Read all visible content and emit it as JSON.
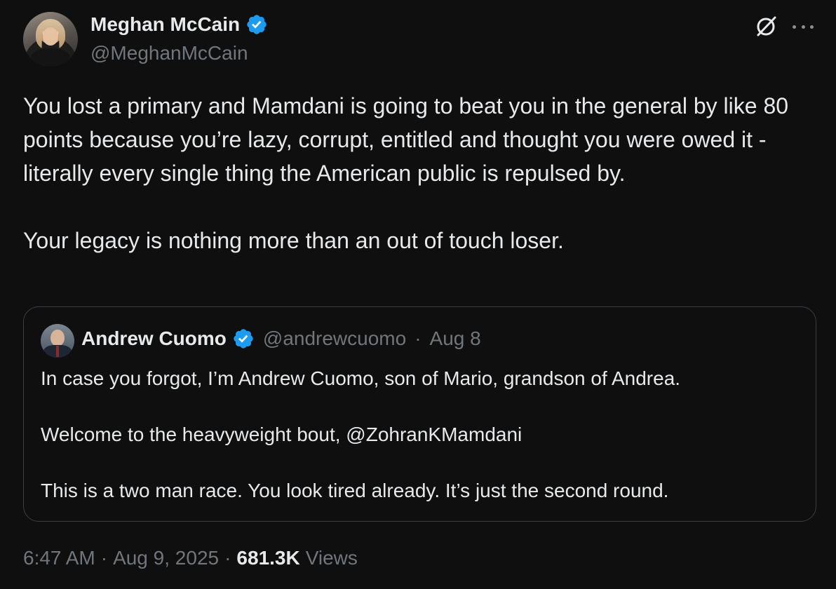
{
  "author": {
    "name": "Meghan McCain",
    "handle": "@MeghanMcCain",
    "verified": true,
    "verified_color": "#1d9bf0"
  },
  "icons": {
    "top_right": [
      "grok-icon",
      "more-icon"
    ],
    "verified": "verified-badge-icon"
  },
  "tweet": {
    "text": "You lost a primary and Mamdani is going to beat you in the general by like 80 points because you’re lazy, corrupt, entitled and thought you were owed it - literally every single thing the American public is repulsed by.\n\nYour legacy is nothing more than an out of touch loser."
  },
  "quote": {
    "name": "Andrew Cuomo",
    "handle": "@andrewcuomo",
    "separator": "·",
    "date": "Aug 8",
    "verified": true,
    "text": "In case you forgot, I’m Andrew Cuomo, son of Mario, grandson of Andrea.\n\nWelcome to the heavyweight bout, @ZohranKMamdani\n\nThis is a two man race. You look tired already. It’s just the second round."
  },
  "footer": {
    "time": "6:47 AM",
    "separator": "·",
    "date": "Aug 9, 2025",
    "views_count": "681.3K",
    "views_label": "Views"
  },
  "colors": {
    "background": "#0f0f10",
    "text_primary": "#e7e9ea",
    "text_secondary": "#71767b",
    "border": "#3b3f44"
  }
}
